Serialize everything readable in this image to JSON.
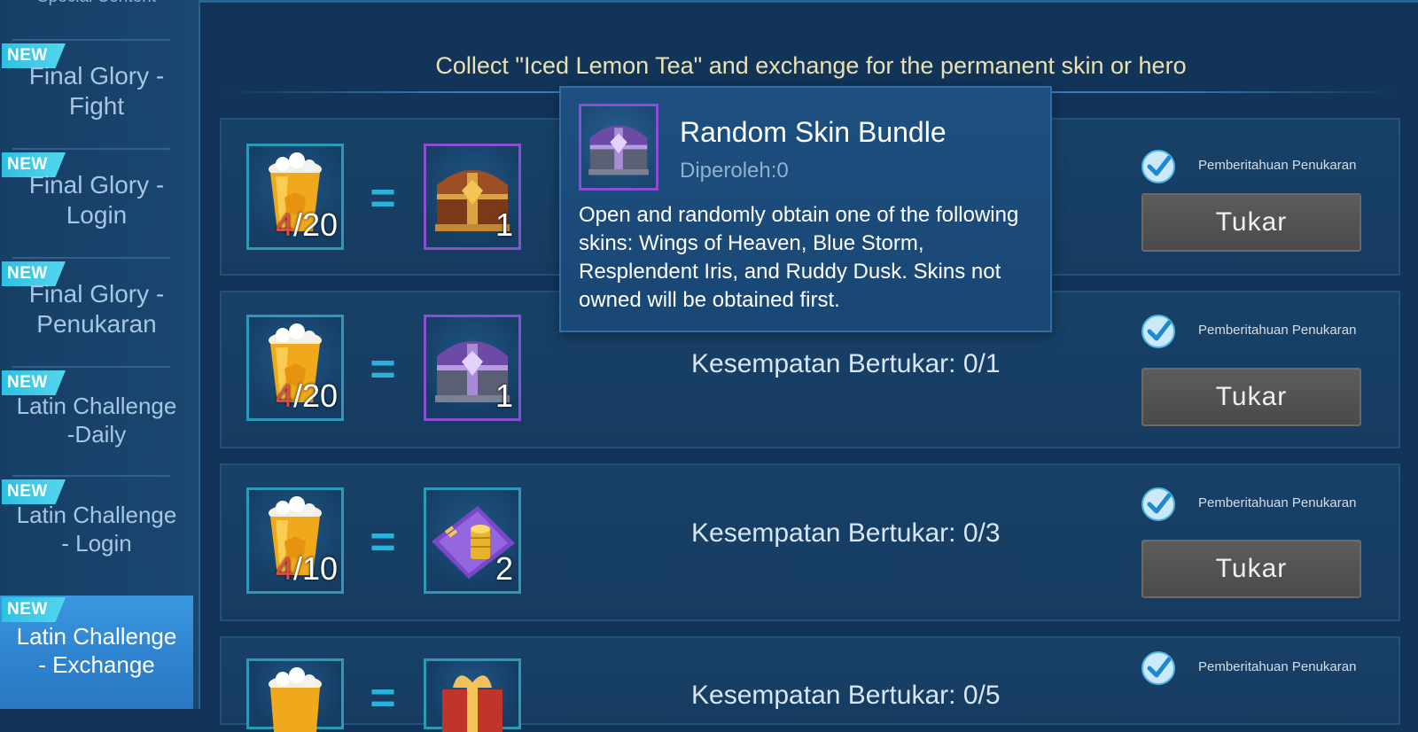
{
  "sidebar": {
    "partial_top_label": "Special Content",
    "items": [
      {
        "badge": "NEW",
        "label": "Final Glory -\nFight",
        "active": false
      },
      {
        "badge": "NEW",
        "label": "Final Glory -\nLogin",
        "active": false
      },
      {
        "badge": "NEW",
        "label": "Final Glory -\nPenukaran",
        "active": false
      },
      {
        "badge": "NEW",
        "label": "Latin Challenge\n-Daily",
        "active": false
      },
      {
        "badge": "NEW",
        "label": "Latin Challenge\n- Login",
        "active": false
      },
      {
        "badge": "NEW",
        "label": "Latin Challenge\n- Exchange",
        "active": true
      }
    ]
  },
  "header": {
    "text": "Collect \"Iced Lemon Tea\" and exchange for the permanent skin or hero"
  },
  "rows": [
    {
      "cost_have": "4",
      "cost_need": "/20",
      "reward_qty": "1",
      "reward_icon": "treasure-chest-gold-icon",
      "chance": "",
      "notif": "Pemberitahuan Penukaran",
      "button": "Tukar"
    },
    {
      "cost_have": "4",
      "cost_need": "/20",
      "reward_qty": "1",
      "reward_icon": "treasure-chest-purple-icon",
      "chance": "Kesempatan Bertukar: 0/1",
      "notif": "Pemberitahuan Penukaran",
      "button": "Tukar"
    },
    {
      "cost_have": "4",
      "cost_need": "/10",
      "reward_qty": "2",
      "reward_icon": "coin-ticket-icon",
      "chance": "Kesempatan Bertukar: 0/3",
      "notif": "Pemberitahuan Penukaran",
      "button": "Tukar"
    },
    {
      "cost_have": "",
      "cost_need": "",
      "reward_qty": "",
      "reward_icon": "gift-box-icon",
      "chance": "Kesempatan Bertukar: 0/5",
      "notif": "Pemberitahuan Penukaran",
      "button": ""
    }
  ],
  "tooltip": {
    "title": "Random Skin Bundle",
    "obtained": "Diperoleh:0",
    "description": "Open and randomly obtain one of the following skins: Wings of Heaven, Blue Storm, Resplendent Iris, and Ruddy Dusk. Skins not owned will be obtained first.",
    "icon": "treasure-chest-purple-icon"
  },
  "colors": {
    "background": "#123459",
    "accent_teal": "#2bb2d8",
    "header_text": "#e9e1b0",
    "active_tab": "#3b98e0",
    "cost_have": "#e8474b"
  }
}
